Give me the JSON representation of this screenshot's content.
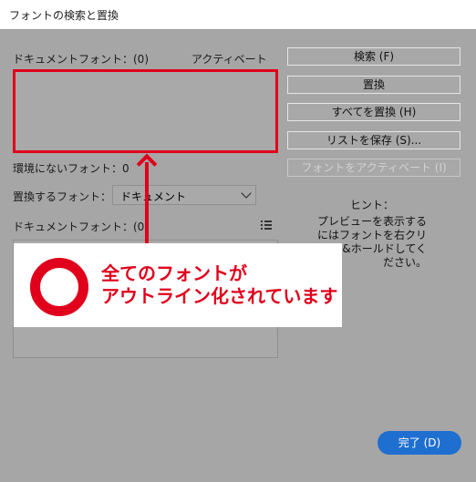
{
  "window": {
    "title": "フォントの検索と置換"
  },
  "doc_fonts": {
    "label": "ドキュメントフォント：(0)",
    "activate": "アクティベート"
  },
  "missing_fonts": {
    "label": "環境にないフォント：0"
  },
  "replace": {
    "label": "置換するフォント：",
    "selected": "ドキュメント"
  },
  "doc_fonts2": {
    "label": "ドキュメントフォント：(0)"
  },
  "buttons": {
    "search": "検索 (F)",
    "replace": "置換",
    "replace_all": "すべてを置換 (H)",
    "save_list": "リストを保存 (S)...",
    "activate_font": "フォントをアクティベート (I)"
  },
  "hint": {
    "title": "ヒント：",
    "text": "プレビューを表示するにはフォントを右クリック&ホールドしてください。"
  },
  "done": "完了 (D)",
  "callout": {
    "line1": "全てのフォントが",
    "line2": "アウトライン化されています"
  },
  "colors": {
    "accent": "#e0001b",
    "primary_button": "#1f6fd0"
  }
}
